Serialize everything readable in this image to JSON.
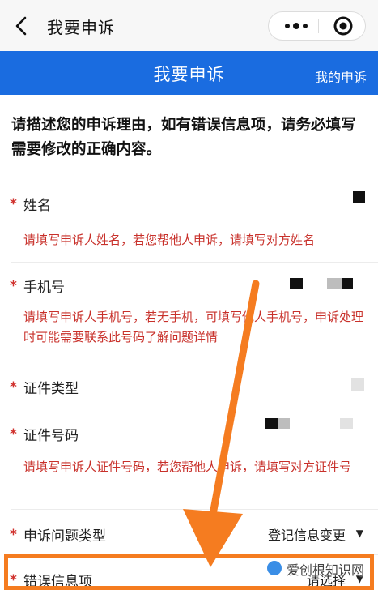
{
  "navbar": {
    "title": "我要申诉",
    "back_icon": "chevron-left-icon",
    "more_icon": "more-dots-icon",
    "close_icon": "target-circle-icon"
  },
  "header": {
    "title": "我要申诉",
    "link": "我的申诉",
    "color": "#1a6ce0"
  },
  "intro": "请描述您的申诉理由，如有错误信息项，请务必填写需要修改的正确内容。",
  "form": {
    "required_mark": "*",
    "name": {
      "label": "姓名",
      "hint": "请填写申诉人姓名，若您帮他人申诉，请填写对方姓名"
    },
    "phone": {
      "label": "手机号",
      "hint": "请填写申诉人手机号，若无手机，可填写他人手机号，申诉处理时可能需要联系此号码了解问题详情"
    },
    "id_type": {
      "label": "证件类型"
    },
    "id_number": {
      "label": "证件号码",
      "hint": "请填写申诉人证件号码，若您帮他人申诉，请填写对方证件号"
    },
    "issue_type": {
      "label": "申诉问题类型",
      "value": "登记信息变更"
    },
    "error_item": {
      "label": "错误信息项",
      "value": "请选择"
    }
  },
  "annotation": {
    "color": "#f57c20"
  },
  "watermark": {
    "text": "爱创根知识网"
  },
  "colors": {
    "required": "#d0312d",
    "hint": "#c8302a"
  }
}
